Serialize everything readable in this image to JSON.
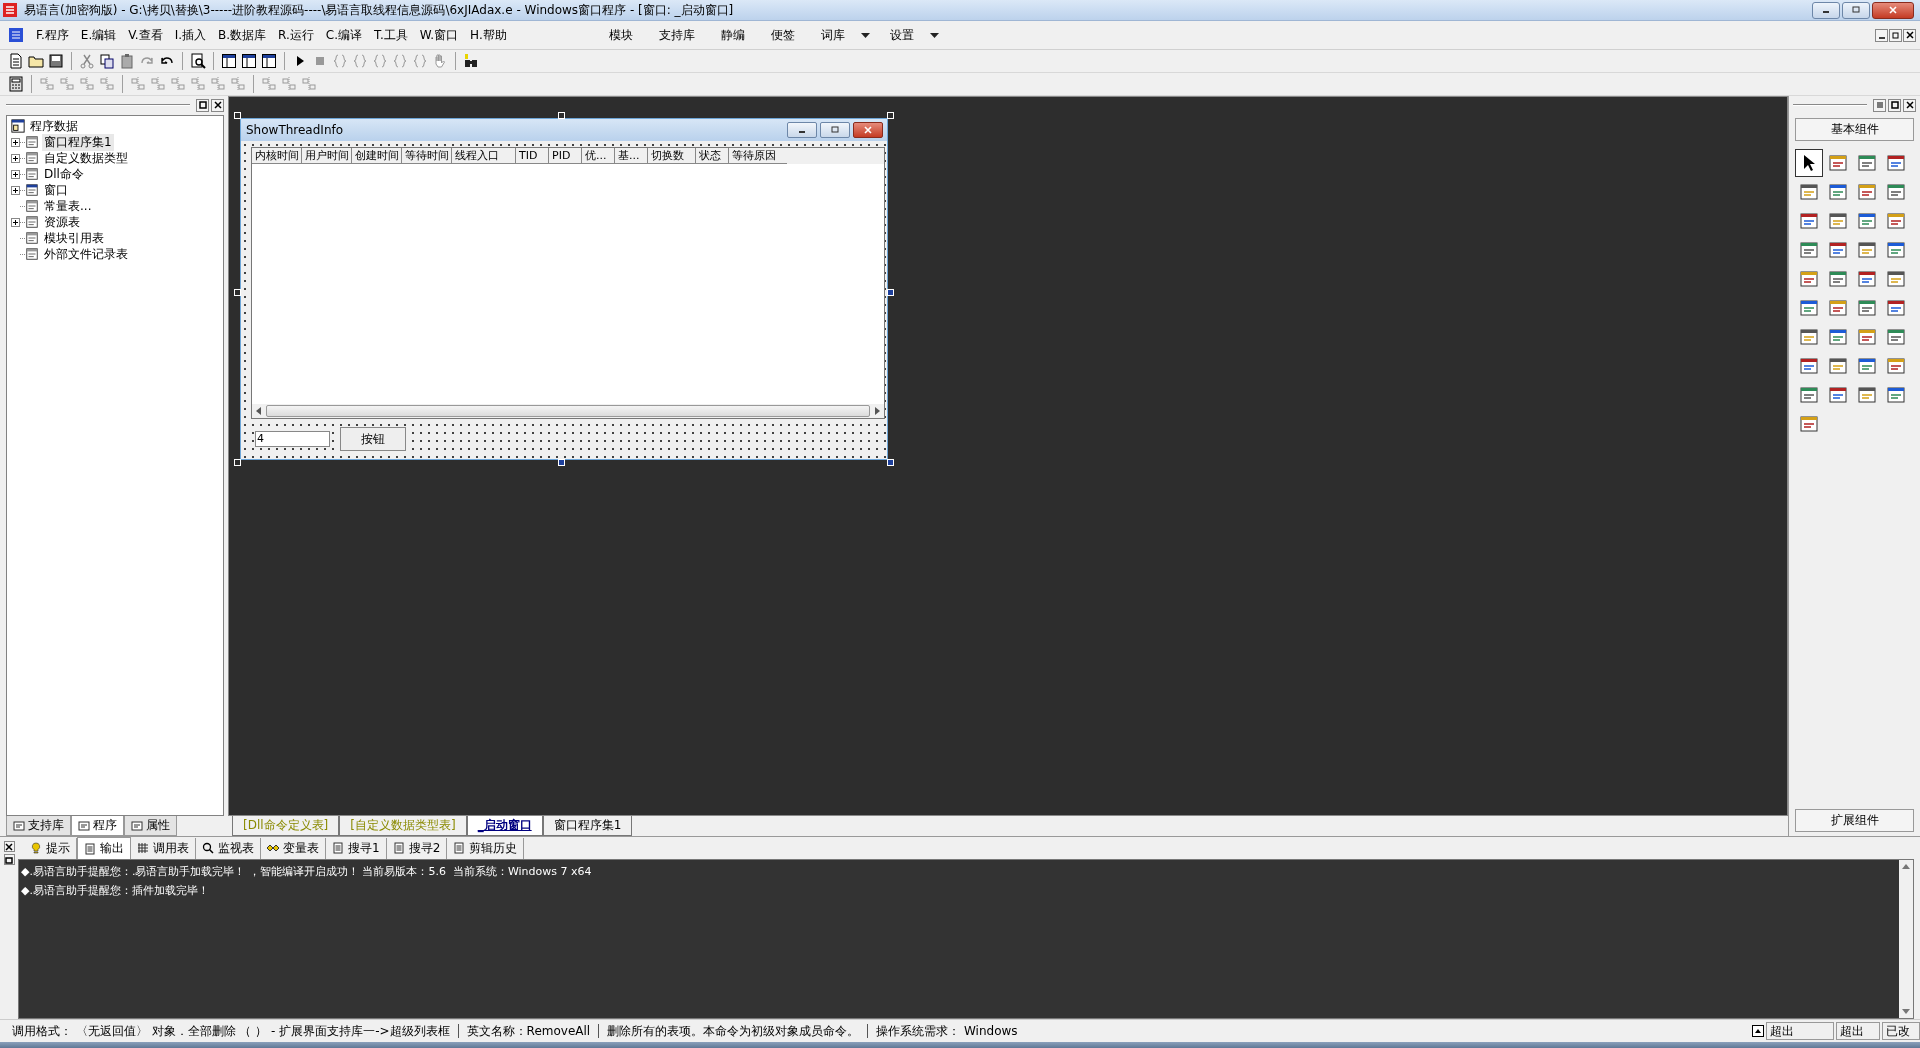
{
  "window": {
    "title": "易语言(加密狗版) - G:\\拷贝\\替换\\3-----进阶教程源码----\\易语言取线程信息源码\\6xJIAdax.e - Windows窗口程序 - [窗口: _启动窗口]"
  },
  "menu": [
    {
      "label": "F.程序"
    },
    {
      "label": "E.编辑"
    },
    {
      "label": "V.查看"
    },
    {
      "label": "I.插入"
    },
    {
      "label": "B.数据库"
    },
    {
      "label": "R.运行"
    },
    {
      "label": "C.编译"
    },
    {
      "label": "T.工具"
    },
    {
      "label": "W.窗口"
    },
    {
      "label": "H.帮助"
    }
  ],
  "quick_menu": [
    {
      "label": "模块",
      "dropdown": false
    },
    {
      "label": "支持库",
      "dropdown": false
    },
    {
      "label": "静编",
      "dropdown": false
    },
    {
      "label": "便签",
      "dropdown": false
    },
    {
      "label": "词库",
      "dropdown": true
    },
    {
      "label": "设置",
      "dropdown": true
    }
  ],
  "tree": {
    "label": "程序数据",
    "children": [
      {
        "label": "窗口程序集1",
        "kind": "folder",
        "selected": true
      },
      {
        "label": "自定义数据类型",
        "kind": "folder",
        "selected": false
      },
      {
        "label": "Dll命令",
        "kind": "folder",
        "selected": false
      },
      {
        "label": "窗口",
        "kind": "folder",
        "selected": false
      },
      {
        "label": "常量表...",
        "kind": "leaf",
        "selected": false
      },
      {
        "label": "资源表",
        "kind": "folder",
        "selected": false
      },
      {
        "label": "模块引用表",
        "kind": "leaf",
        "selected": false
      },
      {
        "label": "外部文件记录表",
        "kind": "leaf",
        "selected": false
      }
    ]
  },
  "left_tabs": [
    {
      "label": "支持库",
      "selected": false
    },
    {
      "label": "程序",
      "selected": true
    },
    {
      "label": "属性",
      "selected": false
    }
  ],
  "design_window": {
    "title": "ShowThreadInfo",
    "columns": [
      "内核时间",
      "用户时间",
      "创建时间",
      "等待时间",
      "线程入口",
      "TID",
      "PID",
      "优...",
      "基...",
      "切换数",
      "状态",
      "等待原因"
    ],
    "input_value": "4",
    "button": "按钮"
  },
  "editor_tabs": [
    {
      "label": "[Dll命令定义表]",
      "selected": false,
      "color": "#8a8a00"
    },
    {
      "label": "[自定义数据类型表]",
      "selected": false,
      "color": "#8a8a00"
    },
    {
      "label": "_启动窗口",
      "selected": true,
      "color": "#000080"
    },
    {
      "label": "窗口程序集1",
      "selected": false,
      "color": "#000000"
    }
  ],
  "palette": {
    "title": "基本组件",
    "footer": "扩展组件"
  },
  "output_tabs": [
    {
      "label": "提示",
      "selected": false
    },
    {
      "label": "输出",
      "selected": true
    },
    {
      "label": "调用表",
      "selected": false
    },
    {
      "label": "监视表",
      "selected": false
    },
    {
      "label": "变量表",
      "selected": false
    },
    {
      "label": "搜寻1",
      "selected": false
    },
    {
      "label": "搜寻2",
      "selected": false
    },
    {
      "label": "剪辑历史",
      "selected": false
    }
  ],
  "output_lines": [
    "◆.易语言助手提醒您：.易语言助手加载完毕！ ，智能编译开启成功！ 当前易版本：5.6  当前系统：Windows 7 x64",
    "◆.易语言助手提醒您：插件加载完毕！"
  ],
  "status_bar": {
    "segments": [
      "调用格式： 〈无返回值〉 对象．全部删除 （ ） - 扩展界面支持库一->超级列表框",
      "英文名称：RemoveAll",
      "删除所有的表项。本命令为初级对象成员命令。",
      "操作系统需求： Windows"
    ],
    "fields": [
      "超出",
      "超出",
      "已改"
    ]
  }
}
